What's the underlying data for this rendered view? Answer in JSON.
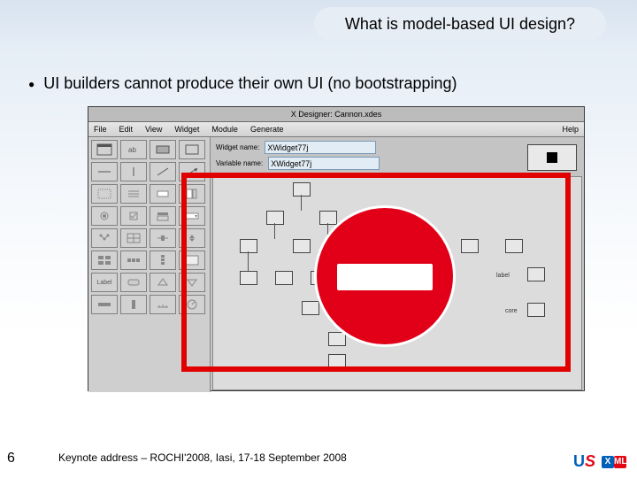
{
  "title": "What is model-based UI design?",
  "bullet": "UI builders cannot produce their own UI (no bootstrapping)",
  "page_number": "6",
  "footer": "Keynote address – ROCHI'2008, Iasi, 17-18 September 2008",
  "logo": {
    "u": "U",
    "s": "S",
    "x": "X",
    "ml": "ML"
  },
  "app": {
    "title": "X Designer: Cannon.xdes",
    "menu": [
      "File",
      "Edit",
      "View",
      "Widget",
      "Module",
      "Generate",
      "Help"
    ],
    "fields": {
      "widget_label": "Widget name:",
      "widget_value": "XWidget77j",
      "var_label": "Variable name:",
      "var_value": "XWidget77j"
    },
    "toolbox_label": "Label",
    "canvas_labels": [
      "label",
      "core"
    ]
  }
}
